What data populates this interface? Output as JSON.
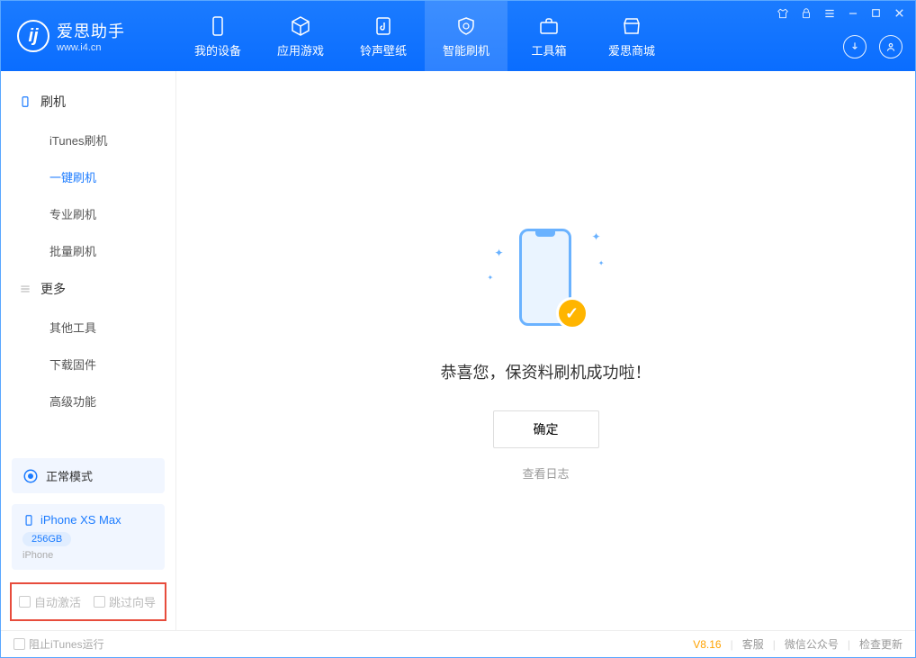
{
  "app": {
    "name_cn": "爱思助手",
    "url": "www.i4.cn"
  },
  "tabs": {
    "device": "我的设备",
    "apps": "应用游戏",
    "ringtones": "铃声壁纸",
    "flash": "智能刷机",
    "toolbox": "工具箱",
    "store": "爱思商城"
  },
  "sidebar": {
    "group_flash": "刷机",
    "items_flash": {
      "itunes": "iTunes刷机",
      "oneclick": "一键刷机",
      "pro": "专业刷机",
      "batch": "批量刷机"
    },
    "group_more": "更多",
    "items_more": {
      "other": "其他工具",
      "firmware": "下载固件",
      "advanced": "高级功能"
    }
  },
  "mode": {
    "label": "正常模式"
  },
  "device": {
    "name": "iPhone XS Max",
    "storage": "256GB",
    "type": "iPhone"
  },
  "checks": {
    "auto_activate": "自动激活",
    "skip_wizard": "跳过向导"
  },
  "main": {
    "success": "恭喜您，保资料刷机成功啦！",
    "ok": "确定",
    "view_log": "查看日志"
  },
  "footer": {
    "block_itunes": "阻止iTunes运行",
    "version": "V8.16",
    "support": "客服",
    "wechat": "微信公众号",
    "update": "检查更新"
  }
}
